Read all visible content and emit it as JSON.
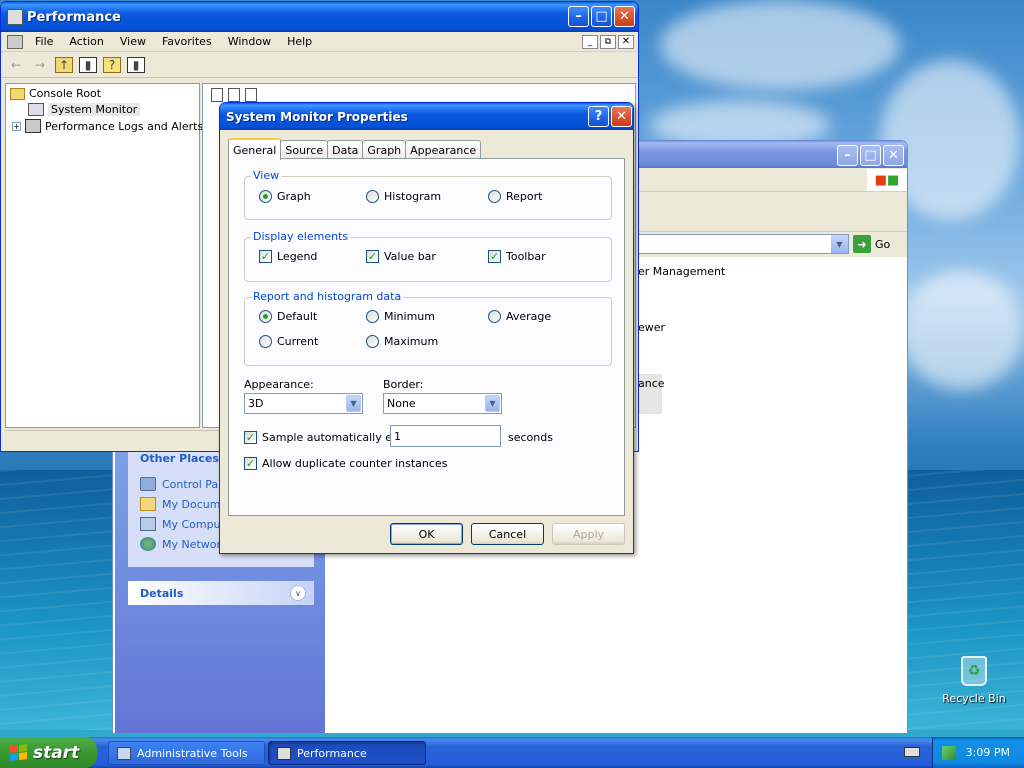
{
  "performance_window": {
    "title": "Performance",
    "menu": [
      "File",
      "Action",
      "View",
      "Favorites",
      "Window",
      "Help"
    ],
    "tree": [
      {
        "label": "Console Root",
        "icon": "folder-icon"
      },
      {
        "label": "System Monitor",
        "icon": "monitor-icon",
        "selected": true
      },
      {
        "label": "Performance Logs and Alerts",
        "icon": "logs-icon",
        "expandable": true
      }
    ]
  },
  "explorer_window": {
    "go_label": "Go",
    "list_items": [
      "er Management",
      "ewer",
      "ance"
    ],
    "other_places": {
      "title": "Other Places",
      "items": [
        "Control Pan",
        "My Documen",
        "My Compute",
        "My Network"
      ]
    },
    "details_title": "Details"
  },
  "dialog": {
    "title": "System Monitor Properties",
    "tabs": [
      "General",
      "Source",
      "Data",
      "Graph",
      "Appearance"
    ],
    "active_tab": "General",
    "view": {
      "label": "View",
      "options": [
        "Graph",
        "Histogram",
        "Report"
      ],
      "selected": "Graph"
    },
    "display_elements": {
      "label": "Display elements",
      "options": [
        "Legend",
        "Value bar",
        "Toolbar"
      ]
    },
    "report_data": {
      "label": "Report and histogram data",
      "options": [
        "Default",
        "Minimum",
        "Average",
        "Current",
        "Maximum"
      ],
      "selected": "Default"
    },
    "appearance": {
      "label": "Appearance:",
      "value": "3D"
    },
    "border": {
      "label": "Border:",
      "value": "None"
    },
    "sample": {
      "label": "Sample automatically every:",
      "value": "1",
      "unit": "seconds"
    },
    "duplicate": {
      "label": "Allow duplicate counter instances"
    },
    "buttons": {
      "ok": "OK",
      "cancel": "Cancel",
      "apply": "Apply"
    }
  },
  "desktop": {
    "recycle_bin": "Recycle Bin"
  },
  "taskbar": {
    "start": "start",
    "tasks": [
      "Administrative Tools",
      "Performance"
    ],
    "clock": "3:09 PM"
  },
  "colors": {
    "xp_title_blue": "#0550d6",
    "group_label": "#0046d5",
    "check_green": "#21a121"
  }
}
